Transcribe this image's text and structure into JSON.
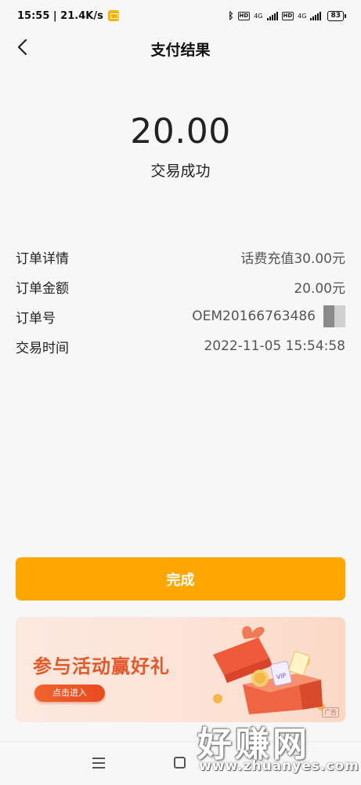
{
  "status_bar": {
    "time_speed": "15:55 | 21.4K/s",
    "network_1": "4G",
    "network_2": "4G",
    "hd_label": "HD",
    "battery": "83"
  },
  "nav": {
    "title": "支付结果"
  },
  "result": {
    "amount": "20.00",
    "status": "交易成功"
  },
  "details": [
    {
      "label": "订单详情",
      "value": "话费充值30.00元"
    },
    {
      "label": "订单金额",
      "value": "20.00元"
    },
    {
      "label": "订单号",
      "value": "OEM20166763486"
    },
    {
      "label": "交易时间",
      "value": "2022-11-05 15:54:58"
    }
  ],
  "done_button": {
    "label": "完成"
  },
  "ad": {
    "title": "参与活动赢好礼",
    "button_label": "点击进入",
    "tag": "广告"
  },
  "watermark": {
    "main": "好赚网",
    "url": "www.zhuanyes.com"
  },
  "colors": {
    "accent": "#ffa700",
    "ad_text": "#e4592b",
    "background": "#f7f7f7"
  }
}
